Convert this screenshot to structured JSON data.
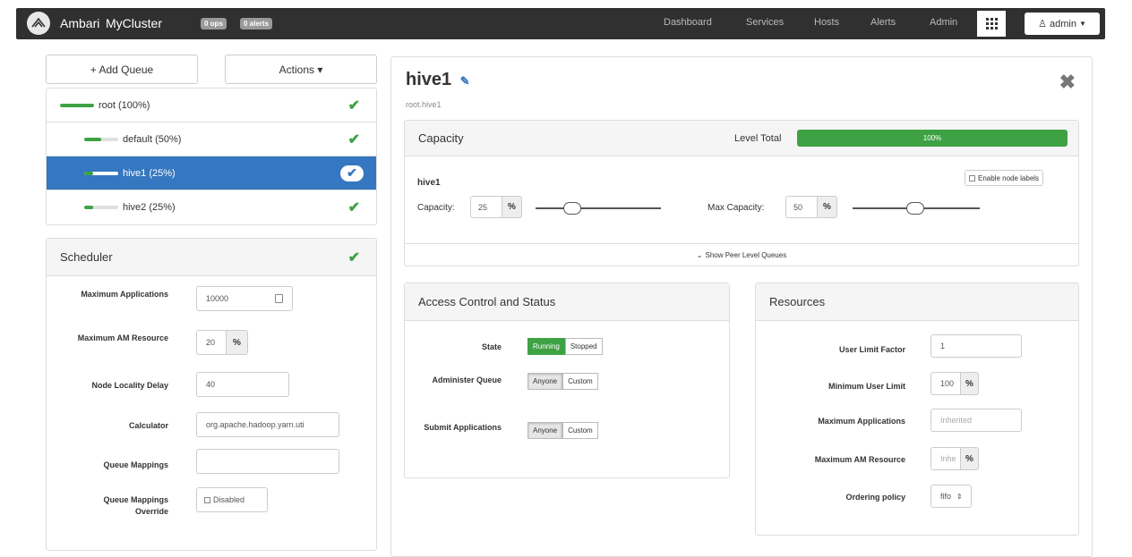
{
  "nav": {
    "brand": "Ambari",
    "cluster": "MyCluster",
    "ops_badge": "0 ops",
    "alerts_badge": "0 alerts",
    "links": [
      "Dashboard",
      "Services",
      "Hosts",
      "Alerts",
      "Admin"
    ],
    "user": "admin"
  },
  "left": {
    "add_queue": "+ Add Queue",
    "actions": "Actions ▾",
    "queues": [
      {
        "label": "root (100%)",
        "level": 100
      },
      {
        "label": "default (50%)",
        "level": 50
      },
      {
        "label": "hive1 (25%)",
        "level": 25
      },
      {
        "label": "hive2 (25%)",
        "level": 25
      }
    ]
  },
  "scheduler": {
    "title": "Scheduler",
    "max_apps_label": "Maximum Applications",
    "max_apps_value": "10000",
    "max_am_label": "Maximum AM Resource",
    "max_am_value": "20",
    "node_locality_label": "Node Locality Delay",
    "node_locality_value": "40",
    "calculator_label": "Calculator",
    "calculator_value": "org.apache.hadoop.yarn.uti",
    "queue_mappings_label": "Queue Mappings",
    "queue_mappings_value": "",
    "override_label": "Queue Mappings Override",
    "override_value": "Disabled",
    "percent": "%"
  },
  "queue": {
    "title": "hive1",
    "path": "root.hive1",
    "capacity_title": "Capacity",
    "level_total_label": "Level Total",
    "level_total_value": "100%",
    "level_total_fraction": 1.0,
    "section_name": "hive1",
    "enable_node_labels": "Enable node labels",
    "capacity_label": "Capacity:",
    "capacity_value": "25",
    "max_capacity_label": "Max Capacity:",
    "max_capacity_value": "50",
    "show_peer": "Show Peer Level Queues",
    "percent": "%"
  },
  "access": {
    "title": "Access Control and Status",
    "state_label": "State",
    "running": "Running",
    "stopped": "Stopped",
    "administer_label": "Administer Queue",
    "submit_label": "Submit Applications",
    "anyone": "Anyone",
    "custom": "Custom"
  },
  "resources": {
    "title": "Resources",
    "user_limit_label": "User Limit Factor",
    "user_limit_value": "1",
    "min_user_label": "Minimum User Limit",
    "min_user_value": "100",
    "max_apps_label": "Maximum Applications",
    "max_apps_placeholder": "Inherited",
    "max_am_label": "Maximum AM Resource",
    "max_am_placeholder": "Inhe",
    "ordering_label": "Ordering policy",
    "ordering_value": "fifo",
    "percent": "%"
  }
}
